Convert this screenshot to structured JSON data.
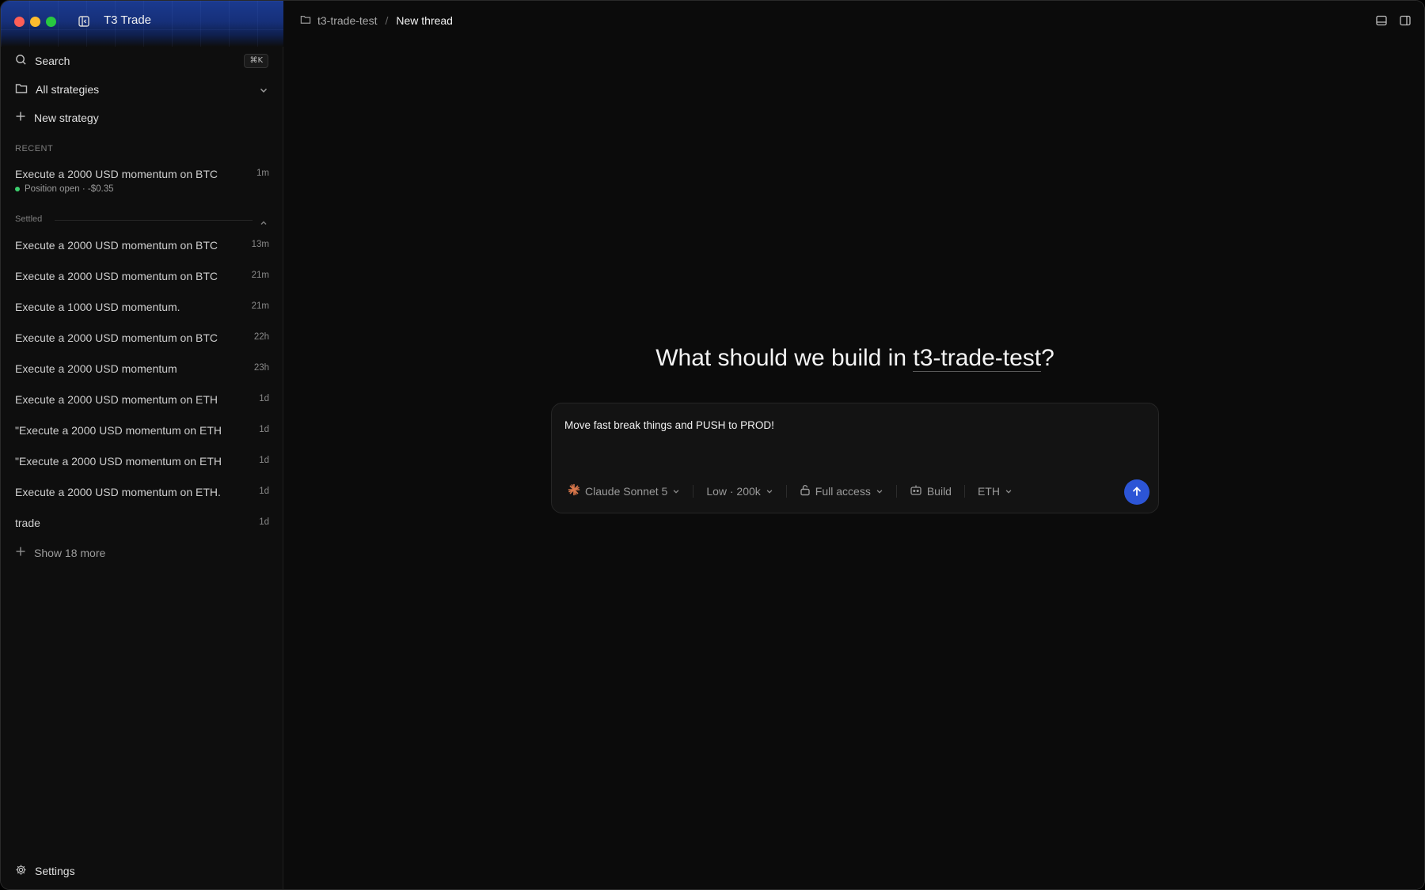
{
  "app": {
    "title": "T3 Trade"
  },
  "sidebar": {
    "search_label": "Search",
    "search_shortcut": "⌘K",
    "strategies_label": "All strategies",
    "new_strategy_label": "New strategy",
    "recent_heading": "RECENT",
    "recent_item": {
      "title": "Execute a 2000 USD momentum on BTC",
      "time": "1m",
      "status": "Position open · -$0.35"
    },
    "settled_heading": "Settled",
    "settled_items": [
      {
        "title": "Execute a 2000 USD momentum on BTC",
        "time": "13m"
      },
      {
        "title": "Execute a 2000 USD momentum on BTC",
        "time": "21m"
      },
      {
        "title": "Execute a 1000 USD momentum.",
        "time": "21m"
      },
      {
        "title": "Execute a 2000 USD momentum on BTC",
        "time": "22h"
      },
      {
        "title": "Execute a 2000 USD momentum",
        "time": "23h"
      },
      {
        "title": "Execute a 2000 USD momentum on ETH",
        "time": "1d"
      },
      {
        "title": "\"Execute a 2000 USD momentum on ETH",
        "time": "1d"
      },
      {
        "title": "\"Execute a 2000 USD momentum on ETH",
        "time": "1d"
      },
      {
        "title": "Execute a 2000 USD momentum on ETH.",
        "time": "1d"
      },
      {
        "title": "trade",
        "time": "1d"
      }
    ],
    "show_more_label": "Show 18 more",
    "settings_label": "Settings"
  },
  "header": {
    "project": "t3-trade-test",
    "separator": "/",
    "current": "New thread"
  },
  "main": {
    "prompt_prefix": "What should we build in ",
    "prompt_project": "t3-trade-test",
    "prompt_suffix": "?",
    "composer": {
      "input_value": "Move fast break things and PUSH to PROD!",
      "model": "Claude Sonnet 5",
      "effort": "Low · 200k",
      "access": "Full access",
      "mode": "Build",
      "asset": "ETH"
    }
  },
  "colors": {
    "accent": "#2c55d6",
    "status_green": "#3ccf6e",
    "claude_orange": "#d9774b"
  }
}
